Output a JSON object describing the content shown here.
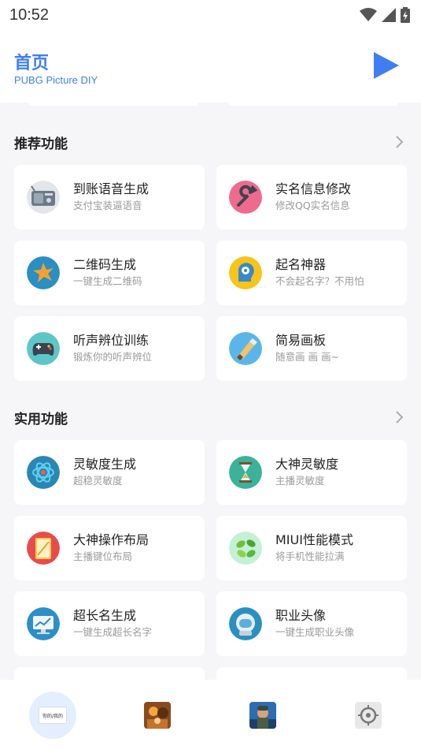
{
  "status_bar": {
    "time": "10:52"
  },
  "header": {
    "title": "首页",
    "subtitle": "PUBG Picture DIY"
  },
  "sections": [
    {
      "title": "推荐功能",
      "items": [
        {
          "name": "到账语音生成",
          "desc": "支付宝装逼语音",
          "icon": "radio-icon"
        },
        {
          "name": "实名信息修改",
          "desc": "修改QQ实名信息",
          "icon": "wrench-icon"
        },
        {
          "name": "二维码生成",
          "desc": "一键生成二维码",
          "icon": "leaf-icon"
        },
        {
          "name": "起名神器",
          "desc": "不会起名字？不用怕",
          "icon": "head-gear-icon"
        },
        {
          "name": "听声辨位训练",
          "desc": "锻炼你的听声辨位",
          "icon": "gamepad-icon"
        },
        {
          "name": "简易画板",
          "desc": "随意画 画 画~",
          "icon": "paint-brush-icon"
        }
      ]
    },
    {
      "title": "实用功能",
      "items": [
        {
          "name": "灵敏度生成",
          "desc": "超稳灵敏度",
          "icon": "atom-icon"
        },
        {
          "name": "大神灵敏度",
          "desc": "主播灵敏度",
          "icon": "hourglass-icon"
        },
        {
          "name": "大神操作布局",
          "desc": "主播键位布局",
          "icon": "tablet-icon"
        },
        {
          "name": "MIUI性能模式",
          "desc": "将手机性能拉满",
          "icon": "leaves-icon"
        },
        {
          "name": "超长名生成",
          "desc": "一键生成超长名字",
          "icon": "monitor-chart-icon"
        },
        {
          "name": "职业头像",
          "desc": "一键生成职业头像",
          "icon": "astronaut-icon"
        }
      ]
    }
  ],
  "bottom_nav": [
    {
      "name": "home-tab",
      "label": "你的/我的",
      "active": true
    },
    {
      "name": "game-art-tab",
      "active": false
    },
    {
      "name": "character-tab",
      "active": false
    },
    {
      "name": "settings-tab",
      "active": false
    }
  ],
  "colors": {
    "accent": "#3f7ef0",
    "background": "#f6f6f8",
    "card": "#ffffff"
  }
}
